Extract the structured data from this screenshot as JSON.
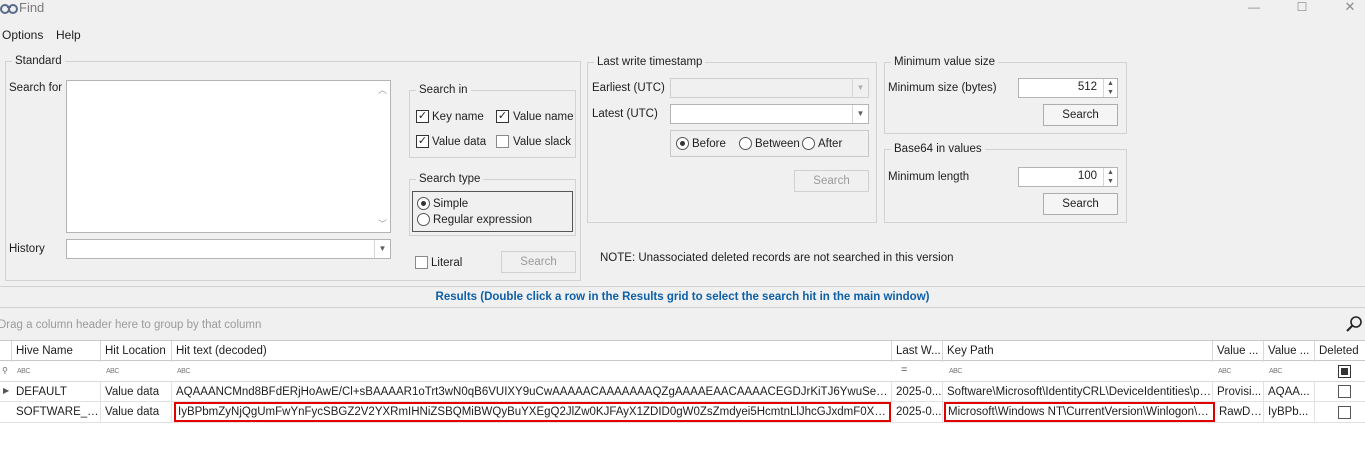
{
  "window": {
    "title": "Find",
    "controls": {
      "minimize": "—",
      "maximize": "☐",
      "close": "✕"
    }
  },
  "menu": {
    "options": "Options",
    "help": "Help"
  },
  "standard": {
    "legend": "Standard",
    "search_for_label": "Search for",
    "history_label": "History",
    "search_in": {
      "legend": "Search in",
      "key_name": {
        "label": "Key name",
        "checked": true
      },
      "value_name": {
        "label": "Value name",
        "checked": true
      },
      "value_data": {
        "label": "Value data",
        "checked": true
      },
      "value_slack": {
        "label": "Value slack",
        "checked": false
      }
    },
    "search_type": {
      "legend": "Search type",
      "options": [
        "Simple",
        "Regular expression"
      ],
      "selected": "Simple"
    },
    "literal_label": "Literal",
    "search_button": "Search"
  },
  "last_write": {
    "legend": "Last write timestamp",
    "earliest_label": "Earliest (UTC)",
    "latest_label": "Latest (UTC)",
    "range_options": [
      "Before",
      "Between",
      "After"
    ],
    "selected": "Before",
    "search_button": "Search"
  },
  "min_value_size": {
    "legend": "Minimum value size",
    "label": "Minimum size (bytes)",
    "value": "512",
    "search_button": "Search"
  },
  "base64": {
    "legend": "Base64 in values",
    "label": "Minimum length",
    "value": "100",
    "search_button": "Search"
  },
  "note": "NOTE: Unassociated deleted records are not searched in this version",
  "results": {
    "header": "Results (Double click a row in the Results grid to select the search hit in the main window)",
    "group_hint": "Drag a column header here to group by that column",
    "columns": [
      "Hive Name",
      "Hit Location",
      "Hit text (decoded)",
      "Last W...",
      "Key Path",
      "Value ...",
      "Value ...",
      "Deleted"
    ],
    "filter_icon": "ABC",
    "filter_equals": "=",
    "rows": [
      {
        "hive": "DEFAULT",
        "location": "Value data",
        "hit_text": "AQAAANCMnd8BFdERjHoAwE/Cl+sBAAAAR1oTrt3wN0qB6VUIXY9uCwAAAAACAAAAAAAQZgAAAAEAACAAAACEGDJrKiTJ6YwuSeLEkMgWjYaZ8W...",
        "last_write": "2025-0...",
        "key_path": "Software\\Microsoft\\IdentityCRL\\DeviceIdentities\\pr...",
        "value_name": "Provisi...",
        "value_data": "AQAA...",
        "deleted": false
      },
      {
        "hive": "SOFTWARE_cl...",
        "location": "Value data",
        "hit_text": "IyBPbmZyNjQgUmFwYnFycSBGZ2V2YXRmIHNiZSBQMiBWQyBuYXEgQ2JlZw0KJFAyX1ZDID0gW0ZsZmdyei5HcmtnLlJhcGJxdmF0XTo6SEdTOC5Ucmd...",
        "last_write": "2025-0...",
        "key_path": "Microsoft\\Windows NT\\CurrentVersion\\Winlogon\\Sile...",
        "value_name": "RawDa...",
        "value_data": "IyBPb...",
        "deleted": false
      }
    ]
  }
}
